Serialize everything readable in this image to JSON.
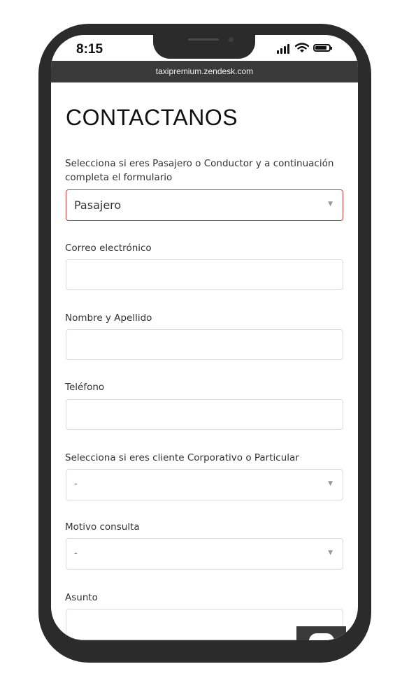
{
  "status_bar": {
    "time": "8:15"
  },
  "browser": {
    "url": "taxipremium.zendesk.com"
  },
  "form": {
    "title": "CONTACTANOS",
    "intro": "Selecciona si eres Pasajero o Conductor y a continuación completa el formulario",
    "user_type": {
      "value": "Pasajero",
      "state": "error",
      "border_color": "#d83a3a"
    },
    "email": {
      "label": "Correo electrónico",
      "value": ""
    },
    "name": {
      "label": "Nombre y Apellido",
      "value": ""
    },
    "phone": {
      "label": "Teléfono",
      "value": ""
    },
    "client_type": {
      "label": "Selecciona si eres cliente Corporativo o Particular",
      "value": "-"
    },
    "reason": {
      "label": "Motivo consulta",
      "value": "-"
    },
    "subject": {
      "label": "Asunto",
      "value": ""
    }
  },
  "icons": [
    "signal-icon",
    "wifi-icon",
    "battery-icon",
    "dropdown-caret-icon",
    "chat-bubble-icon"
  ],
  "colors": {
    "phone_frame": "#2b2b2b",
    "url_bar": "#3a3a3a",
    "field_border": "#dcdcdc",
    "error_border": "#d83a3a"
  }
}
